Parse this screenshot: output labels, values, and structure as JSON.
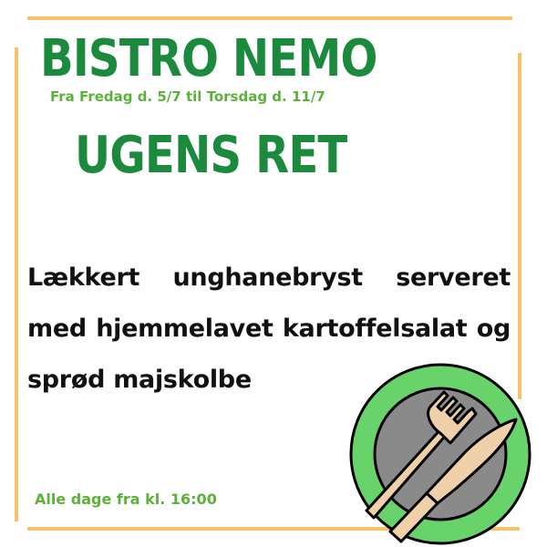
{
  "header": {
    "restaurant_name": "BISTRO NEMO",
    "date_range": "Fra Fredag d. 5/7 til Torsdag d. 11/7"
  },
  "dish": {
    "heading": "UGENS RET",
    "description": "Lækkert unghanebryst serveret med hjemmelavet kartoffelsalat og sprød majskolbe"
  },
  "footer": {
    "hours": "Alle dage fra kl. 16:00"
  },
  "colors": {
    "brand_green": "#1c8a3d",
    "accent_green": "#5cb13a",
    "frame": "#f5c26b",
    "plate_rim": "#69d36b",
    "plate_center": "#8a8a8a",
    "cutlery": "#f0d0a8"
  },
  "icons": [
    "plate-icon",
    "fork-icon",
    "knife-icon"
  ]
}
